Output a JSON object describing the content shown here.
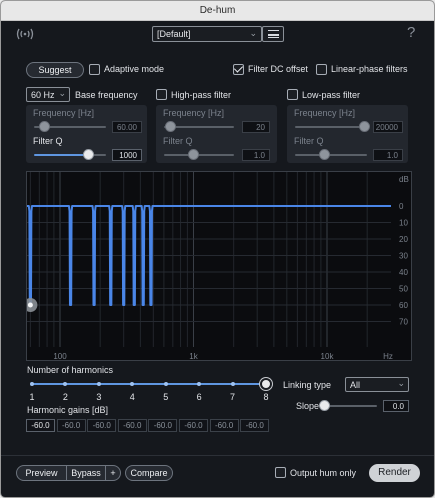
{
  "window": {
    "title": "De-hum"
  },
  "toolbar": {
    "preset": "[Default]",
    "help": "?"
  },
  "controls": {
    "suggest": "Suggest",
    "adaptive_mode": {
      "label": "Adaptive mode",
      "checked": false
    },
    "filter_dc_offset": {
      "label": "Filter DC offset",
      "checked": true
    },
    "linear_phase": {
      "label": "Linear-phase filters",
      "checked": false
    }
  },
  "base": {
    "select": "60 Hz",
    "label": "Base frequency",
    "frequency_label": "Frequency [Hz]",
    "frequency_value": "60.00",
    "q_label": "Filter Q",
    "q_value": "1000"
  },
  "highpass": {
    "label": "High-pass filter",
    "checked": false,
    "frequency_label": "Frequency [Hz]",
    "frequency_value": "20",
    "q_label": "Filter Q",
    "q_value": "1.0"
  },
  "lowpass": {
    "label": "Low-pass filter",
    "checked": false,
    "frequency_label": "Frequency [Hz]",
    "frequency_value": "20000",
    "q_label": "Filter Q",
    "q_value": "1.0"
  },
  "graph": {
    "db_unit": "dB",
    "db_ticks": [
      "0",
      "10",
      "20",
      "30",
      "40",
      "50",
      "60",
      "70"
    ],
    "freq_ticks": [
      "100",
      "1k",
      "10k",
      "Hz"
    ],
    "notch_frequencies_hz": [
      60,
      120,
      180,
      240,
      300,
      360,
      420,
      480
    ],
    "notch_depth_db": -60,
    "color": "#4a86e8"
  },
  "harmonics": {
    "label": "Number of harmonics",
    "ticks": [
      "1",
      "2",
      "3",
      "4",
      "5",
      "6",
      "7",
      "8"
    ],
    "value": 8,
    "gains_label": "Harmonic gains [dB]",
    "gains": [
      "-60.0",
      "-60.0",
      "-60.0",
      "-60.0",
      "-60.0",
      "-60.0",
      "-60.0",
      "-60.0"
    ]
  },
  "linking": {
    "label": "Linking type",
    "value": "All",
    "slope_label": "Slope",
    "slope_value": "0.0"
  },
  "footer": {
    "preview": "Preview",
    "bypass": "Bypass",
    "plus": "+",
    "compare": "Compare",
    "output_hum": {
      "label": "Output hum only",
      "checked": false
    },
    "render": "Render"
  }
}
